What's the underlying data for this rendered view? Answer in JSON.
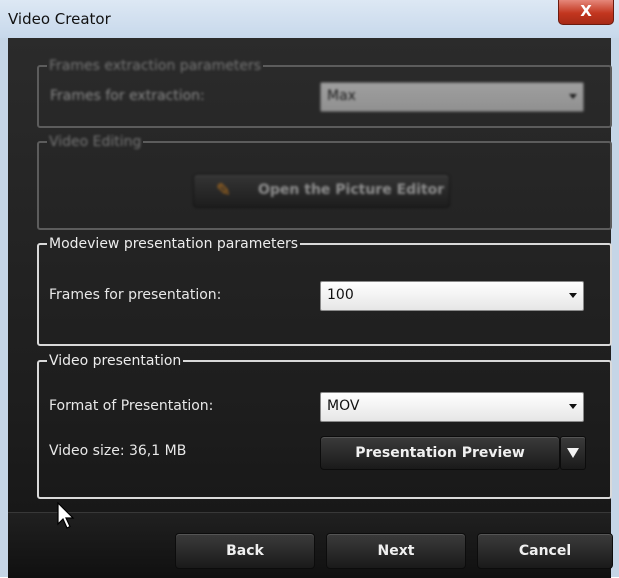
{
  "window": {
    "title": "Video Creator",
    "close_label": "X"
  },
  "frames_extraction": {
    "legend": "Frames extraction parameters",
    "label": "Frames for extraction:",
    "value": "Max"
  },
  "video_editing": {
    "legend": "Video Editing",
    "button_label": "Open the Picture Editor"
  },
  "modeview": {
    "legend": "Modeview presentation parameters",
    "label": "Frames for presentation:",
    "value": "100"
  },
  "video_presentation": {
    "legend": "Video presentation",
    "format_label": "Format of Presentation:",
    "format_value": "MOV",
    "size_text": "Video size: 36,1 MB",
    "preview_button": "Presentation Preview"
  },
  "footer": {
    "back": "Back",
    "next": "Next",
    "cancel": "Cancel"
  },
  "icons": {
    "editor": "pencil-icon",
    "dropdown": "triangle-down-icon",
    "cursor": "mouse-pointer-icon"
  }
}
